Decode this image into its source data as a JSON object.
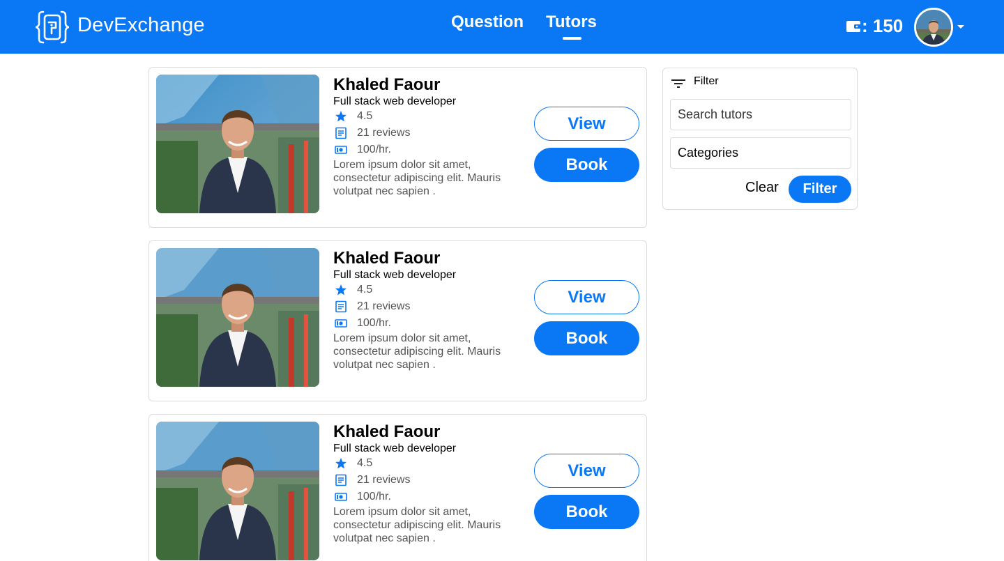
{
  "header": {
    "brand": "DevExchange",
    "nav": [
      {
        "label": "Question",
        "active": false
      },
      {
        "label": "Tutors",
        "active": true
      }
    ],
    "wallet_icon": "wallet-icon",
    "balance": ": 150",
    "accent_color": "#0A78F5"
  },
  "tutors": [
    {
      "name": "Khaled Faour",
      "role": "Full stack web developer",
      "rating": "4.5",
      "reviews": "21 reviews",
      "rate": "100/hr.",
      "description": "Lorem ipsum dolor sit amet, consectetur adipiscing elit. Mauris volutpat nec sapien .",
      "view_label": "View",
      "book_label": "Book"
    },
    {
      "name": "Khaled Faour",
      "role": "Full stack web developer",
      "rating": "4.5",
      "reviews": "21 reviews",
      "rate": "100/hr.",
      "description": "Lorem ipsum dolor sit amet, consectetur adipiscing elit. Mauris volutpat nec sapien .",
      "view_label": "View",
      "book_label": "Book"
    },
    {
      "name": "Khaled Faour",
      "role": "Full stack web developer",
      "rating": "4.5",
      "reviews": "21 reviews",
      "rate": "100/hr.",
      "description": "Lorem ipsum dolor sit amet, consectetur adipiscing elit. Mauris volutpat nec sapien .",
      "view_label": "View",
      "book_label": "Book"
    }
  ],
  "filter": {
    "title": "Filter",
    "search_placeholder": "Search tutors",
    "categories_label": "Categories",
    "clear_label": "Clear",
    "filter_label": "Filter"
  }
}
